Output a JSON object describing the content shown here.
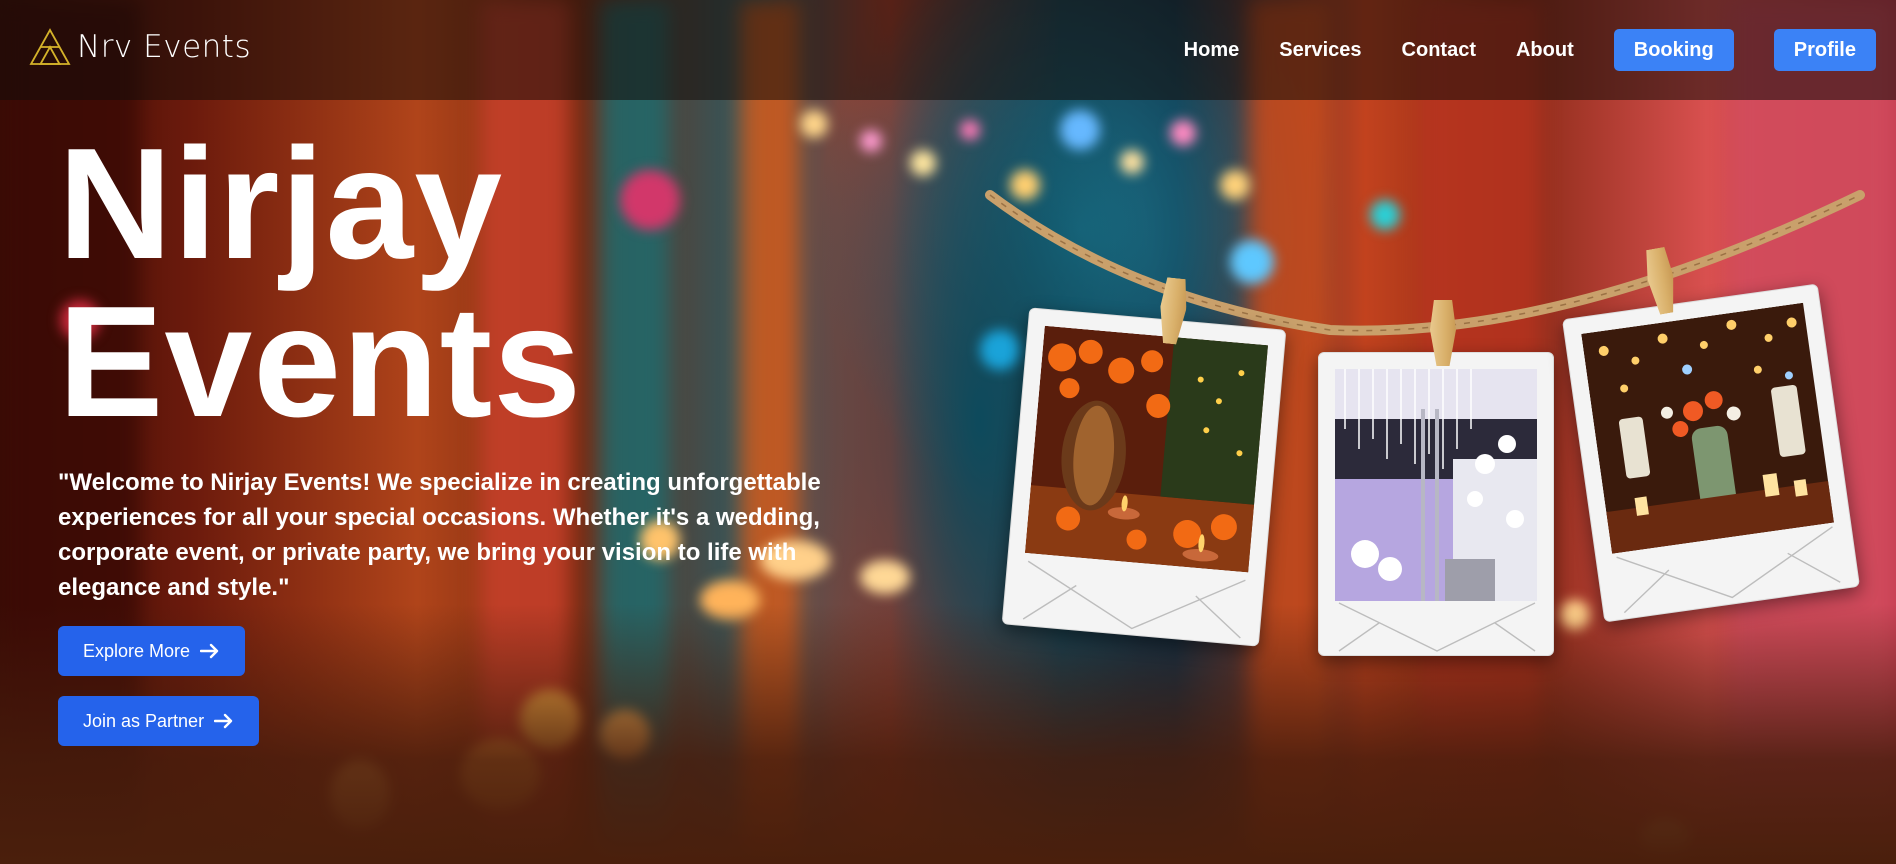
{
  "brand": {
    "name": "Nrv Events",
    "logo_icon": "triangle-logo-icon",
    "logo_color": "#d4b22a"
  },
  "nav": {
    "links": [
      "Home",
      "Services",
      "Contact",
      "About"
    ],
    "booking_label": "Booking",
    "profile_label": "Profile"
  },
  "hero": {
    "title_line1": "Nirjay",
    "title_line2": "Events",
    "description": "\"Welcome to Nirjay Events! We specialize in creating unforgettable experiences for all your special occasions. Whether it's a wedding, corporate event, or private party, we bring your vision to life with elegance and style.\"",
    "explore_label": "Explore More",
    "partner_label": "Join as Partner"
  },
  "gallery": {
    "photos": [
      "marigold-diya-decor-photo",
      "white-floral-stage-photo",
      "candle-floral-centerpiece-photo"
    ]
  },
  "colors": {
    "accent": "#3b82f6",
    "cta": "#2563eb",
    "rope": "#c9a06b"
  }
}
